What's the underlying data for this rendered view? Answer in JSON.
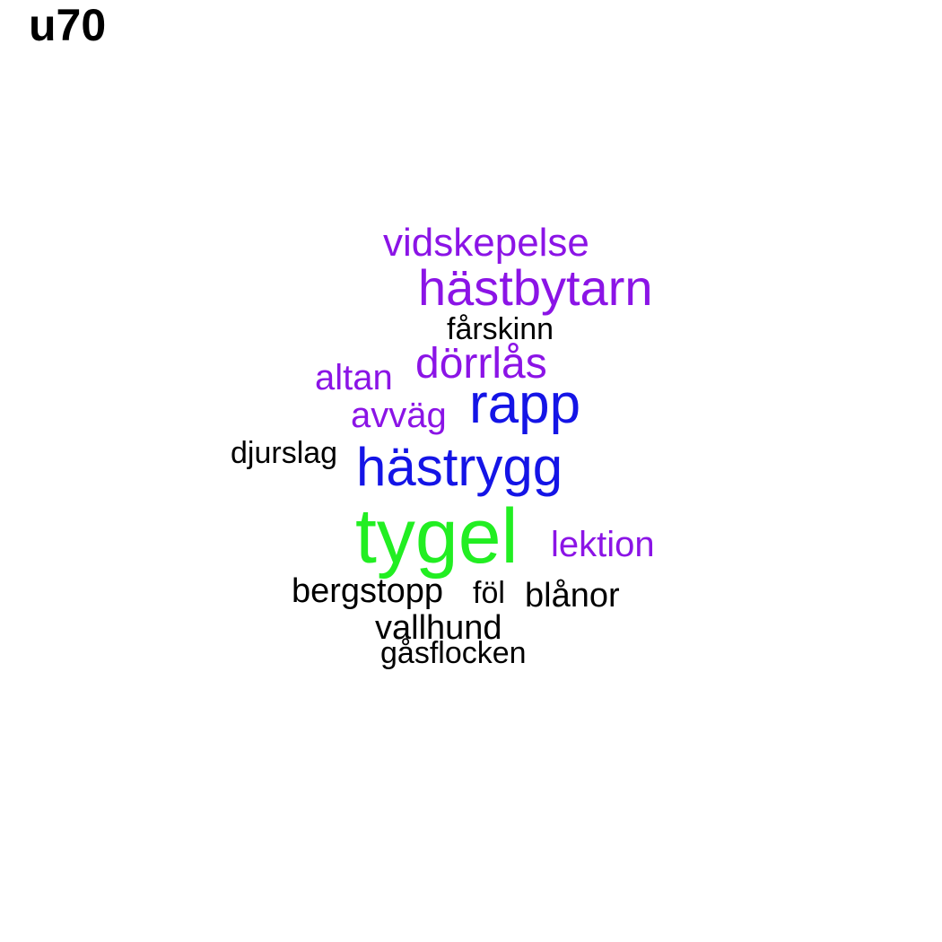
{
  "title": "u70",
  "colors": {
    "green": "#22ee22",
    "blue": "#1414e6",
    "purple": "#8b14e6",
    "black": "#000000"
  },
  "words": [
    {
      "id": "tygel",
      "text": "tygel",
      "color": "green"
    },
    {
      "id": "hastrygg",
      "text": "hästrygg",
      "color": "blue"
    },
    {
      "id": "rapp",
      "text": "rapp",
      "color": "blue"
    },
    {
      "id": "hastbytarn",
      "text": "hästbytarn",
      "color": "purple"
    },
    {
      "id": "vidskepelse",
      "text": "vidskepelse",
      "color": "purple"
    },
    {
      "id": "dorrlas",
      "text": "dörrlås",
      "color": "purple"
    },
    {
      "id": "altan",
      "text": "altan",
      "color": "purple"
    },
    {
      "id": "avvag",
      "text": "avväg",
      "color": "purple"
    },
    {
      "id": "lektion",
      "text": "lektion",
      "color": "purple"
    },
    {
      "id": "farskinn",
      "text": "fårskinn",
      "color": "black"
    },
    {
      "id": "djurslag",
      "text": "djurslag",
      "color": "black"
    },
    {
      "id": "bergstopp",
      "text": "bergstopp",
      "color": "black"
    },
    {
      "id": "fol",
      "text": "föl",
      "color": "black"
    },
    {
      "id": "blanor",
      "text": "blånor",
      "color": "black"
    },
    {
      "id": "vallhund",
      "text": "vallhund",
      "color": "black"
    },
    {
      "id": "gasflocken",
      "text": "gåsflocken",
      "color": "black"
    }
  ]
}
